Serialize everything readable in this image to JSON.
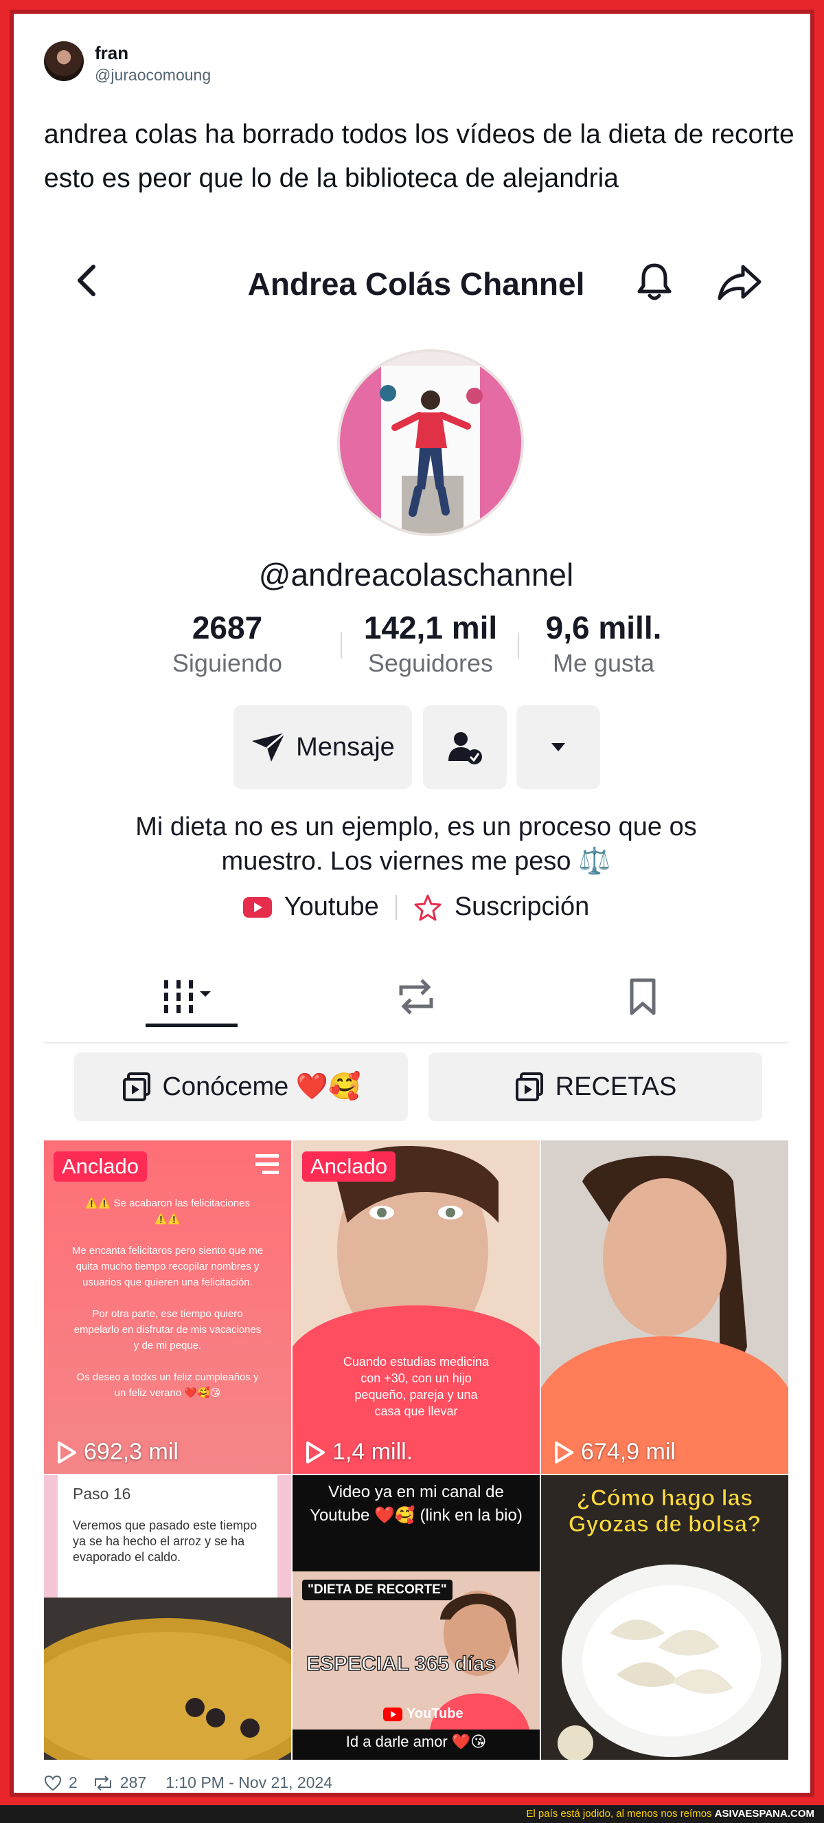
{
  "tweet": {
    "name": "fran",
    "handle": "@juraocomoung",
    "text": "andrea colas ha borrado todos los vídeos de la dieta de recorte esto es peor que lo de la biblioteca de alejandria",
    "likes": "2",
    "retweets": "287",
    "timestamp": "1:10 PM - Nov 21, 2024"
  },
  "profile": {
    "channel_title": "Andrea Colás Channel",
    "username": "@andreacolaschannel",
    "stats": [
      {
        "value": "2687",
        "label": "Siguiendo"
      },
      {
        "value": "142,1 mil",
        "label": "Seguidores"
      },
      {
        "value": "9,6 mill.",
        "label": "Me gusta"
      }
    ],
    "message_button": "Mensaje",
    "bio_line1": "Mi dieta no es un ejemplo, es un proceso que os",
    "bio_line2": "muestro. Los viernes me peso ⚖️",
    "link_youtube": "Youtube",
    "link_subscription": "Suscripción",
    "playlists": [
      {
        "label": "Conóceme ❤️🥰"
      },
      {
        "label": "RECETAS"
      }
    ]
  },
  "videos": [
    {
      "pinned": "Anclado",
      "views": "692,3 mil",
      "overlay": "⚠️⚠️ Se acabaron las felicitaciones ⚠️⚠️\n\nMe encanta felicitaros pero siento que me quita mucho tiempo recopilar nombres y usuarios que quieren una felicitación.\n\nPor otra parte, ese tiempo quiero empelarlo en disfrutar de mis vacaciones y de mi peque.\n\nOs deseo a todxs un feliz cumpleaños y un feliz verano ❤️🥰😘"
    },
    {
      "pinned": "Anclado",
      "views": "1,4 mill.",
      "overlay": "Cuando estudias medicina con +30, con un hijo pequeño, pareja y una casa que llevar"
    },
    {
      "pinned": "",
      "views": "674,9 mil",
      "overlay": ""
    },
    {
      "pinned": "",
      "views": "",
      "overlay_title": "Paso 16",
      "overlay": "Veremos que pasado este tiempo ya se ha hecho el arroz y se ha evaporado el caldo."
    },
    {
      "pinned": "",
      "views": "",
      "overlay_title": "Video ya en mi canal de Youtube ❤️🥰 (link en la bio)",
      "banner": "\"DIETA DE RECORTE\"",
      "banner2": "ESPECIAL 365 días",
      "yt": "YouTube",
      "overlay": "Id a darle amor ❤️😘"
    },
    {
      "pinned": "",
      "views": "",
      "overlay_title": "¿Cómo hago las Gyozas de bolsa?",
      "overlay": ""
    }
  ],
  "footer": {
    "text": "El país está jodido, al menos nos reímos",
    "brand": "ASIVAESPANA.COM"
  },
  "colors": {
    "frame": "#e8262b",
    "pinned_badge": "#fe2c55",
    "text_primary": "#161823",
    "text_secondary": "#6b6d75"
  }
}
